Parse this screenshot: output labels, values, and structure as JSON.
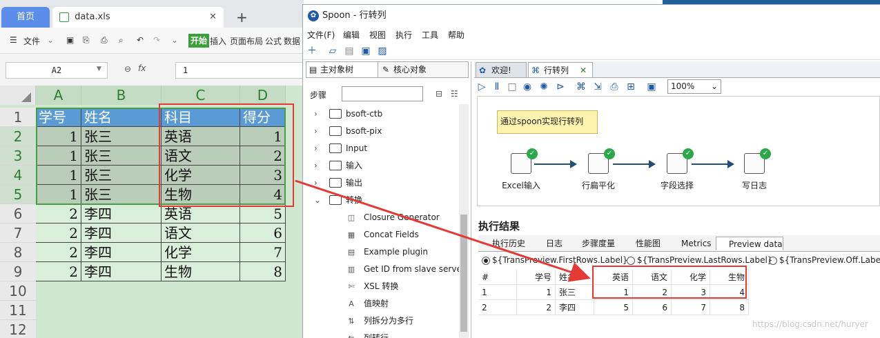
{
  "wps": {
    "tabs": {
      "home": "首页",
      "file": "data.xls"
    },
    "toolbar": {
      "file_menu": "文件",
      "start": "开始",
      "insert": "插入",
      "page_layout": "页面布局",
      "formula": "公式",
      "data": "数据"
    },
    "name_box": "A2",
    "fx": "fx",
    "formula_value": "1",
    "columns": [
      "A",
      "B",
      "C",
      "D"
    ],
    "rows": [
      "1",
      "2",
      "3",
      "4",
      "5",
      "6",
      "7",
      "8",
      "9",
      "10",
      "11",
      "12"
    ],
    "header": [
      "学号",
      "姓名",
      "科目",
      "得分"
    ],
    "data": [
      [
        "1",
        "张三",
        "英语",
        "1"
      ],
      [
        "1",
        "张三",
        "语文",
        "2"
      ],
      [
        "1",
        "张三",
        "化学",
        "3"
      ],
      [
        "1",
        "张三",
        "生物",
        "4"
      ],
      [
        "2",
        "李四",
        "英语",
        "5"
      ],
      [
        "2",
        "李四",
        "语文",
        "6"
      ],
      [
        "2",
        "李四",
        "化学",
        "7"
      ],
      [
        "2",
        "李四",
        "生物",
        "8"
      ]
    ]
  },
  "spoon": {
    "title": "Spoon - 行转列",
    "menu": [
      "文件(F)",
      "编辑",
      "视图",
      "执行",
      "工具",
      "帮助"
    ],
    "left_tabs": {
      "main": "主对象树",
      "core": "核心对象"
    },
    "search_label": "步骤",
    "tree": [
      "bsoft-ctb",
      "bsoft-pix",
      "Input",
      "输入",
      "输出",
      "转换"
    ],
    "sub": [
      "Closure Generator",
      "Concat Fields",
      "Example plugin",
      "Get ID from slave serve",
      "XSL 转换",
      "值映射",
      "列拆分为多行",
      "列转行"
    ],
    "main_tabs": {
      "welcome": "欢迎!",
      "trans": "行转列"
    },
    "zoom": "100%",
    "note": "通过spoon实现行转列",
    "steps": [
      "Excel输入",
      "行扁平化",
      "字段选择",
      "写日志"
    ],
    "results_title": "执行结果",
    "result_tabs": [
      "执行历史",
      "日志",
      "步骤度量",
      "性能图",
      "Metrics",
      "Preview data"
    ],
    "radios": [
      "${TransPreview.FirstRows.Label}",
      "${TransPreview.LastRows.Label}",
      "${TransPreview.Off.Label}"
    ],
    "preview": {
      "headers": [
        "#",
        "学号",
        "姓名",
        "英语",
        "语文",
        "化学",
        "生物"
      ],
      "rows": [
        [
          "1",
          "1",
          "张三",
          "1",
          "2",
          "3",
          "4"
        ],
        [
          "2",
          "2",
          "李四",
          "5",
          "6",
          "7",
          "8"
        ]
      ]
    }
  },
  "watermark": "https://blog.csdn.net/huryer"
}
